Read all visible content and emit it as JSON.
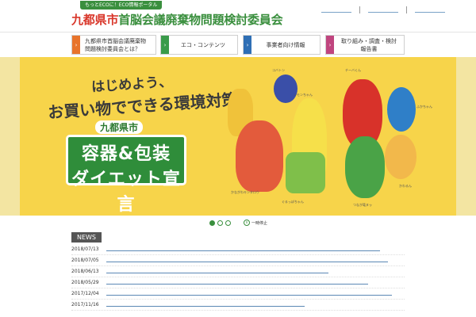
{
  "header": {
    "tagline": "もっとECOに！ECO情報ポータル",
    "title_prefix": "九都県市",
    "title_rest": "首脳会議廃棄物問題検討委員会"
  },
  "nav": {
    "items": [
      {
        "label": "九都県市首脳会議廃棄物問題検討委員会とは？",
        "color": "#e8742c"
      },
      {
        "label": "エコ・コンテンツ",
        "color": "#3a9b4a"
      },
      {
        "label": "事業者向け情報",
        "color": "#2f6fb5"
      },
      {
        "label": "取り組み・調査・検討報告書",
        "color": "#c0457f"
      }
    ]
  },
  "banner": {
    "slogan_line1": "はじめよう、",
    "slogan_line2": "お買い物でできる環境対策。",
    "city": "九都県市",
    "logo_line1": "容器&包装",
    "logo_line2": "ダイエット宣言",
    "mascots": [
      {
        "label": "イーオ"
      },
      {
        "label": "コバトン"
      },
      {
        "label": "レモンちゃん"
      },
      {
        "label": "チーバくん"
      },
      {
        "label": "ぐるっぽちゃん"
      },
      {
        "label": "つなが竜ヌゥ"
      },
      {
        "label": "かながわキンタロウ"
      },
      {
        "label": "ふかちゃん"
      },
      {
        "label": "かわるん"
      }
    ]
  },
  "slider": {
    "pause_label": "一時停止"
  },
  "news": {
    "heading": "NEWS",
    "items": [
      {
        "date": "2018/07/13"
      },
      {
        "date": "2018/07/05"
      },
      {
        "date": "2018/06/13"
      },
      {
        "date": "2018/05/29"
      },
      {
        "date": "2017/12/04"
      },
      {
        "date": "2017/11/16"
      }
    ]
  },
  "colors": {
    "brand_green": "#3a8f3e",
    "accent_red": "#d9372b",
    "banner_yellow": "#f7d44a"
  }
}
